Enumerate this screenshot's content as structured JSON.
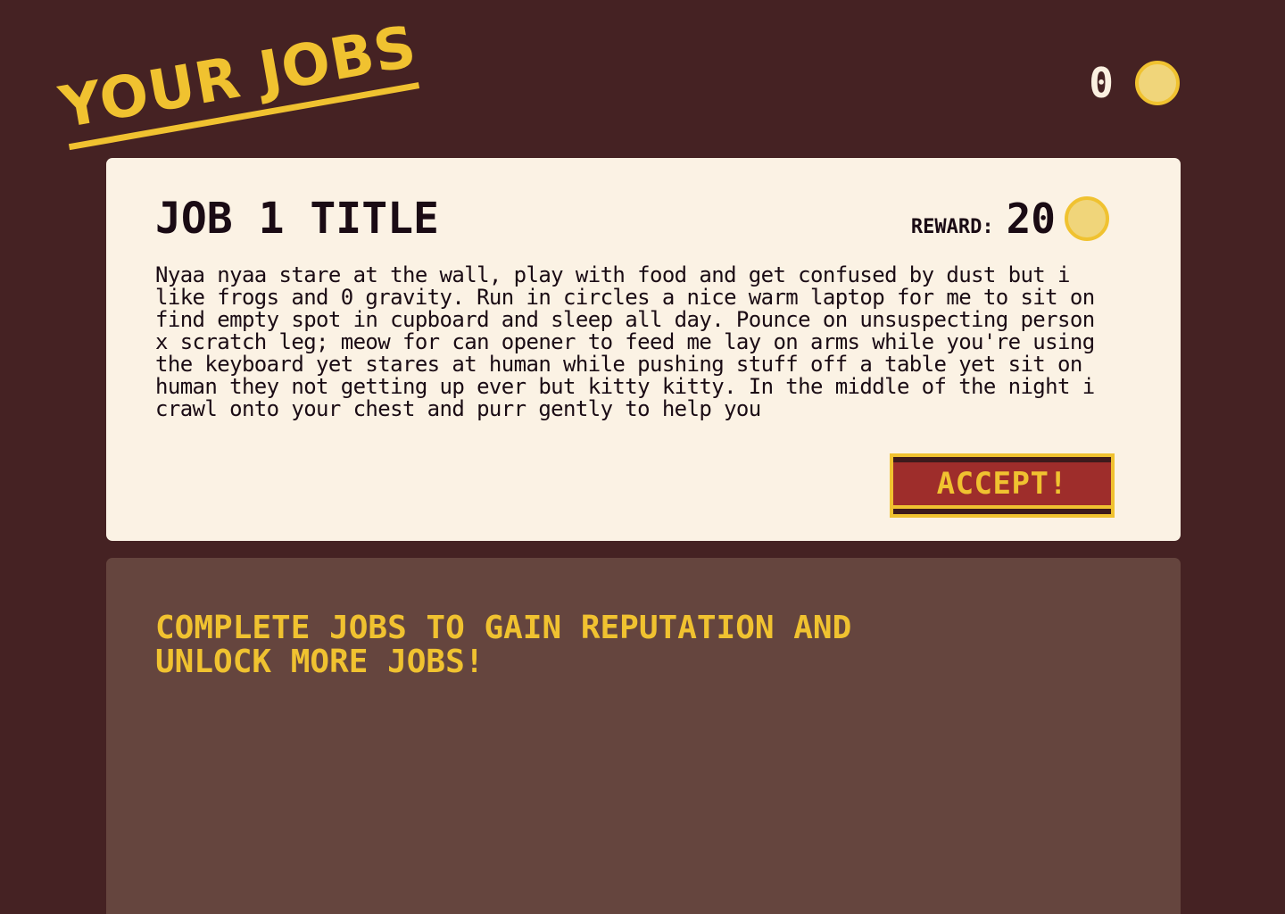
{
  "header": {
    "title": "YOUR JOBS",
    "balance": "0",
    "coin_icon": "coin-icon"
  },
  "jobs": [
    {
      "title": "JOB 1 TITLE",
      "reward_label": "REWARD:",
      "reward_value": "20",
      "reward_icon": "coin-icon",
      "description": "Nyaa nyaa stare at the wall, play with food and get confused by dust but i like frogs and 0 gravity. Run in circles a nice warm laptop for me to sit on find empty spot in cupboard and sleep all day. Pounce on unsuspecting person x scratch leg; meow for can opener to feed me lay on arms while you're using the keyboard yet stares at human while pushing stuff off a table yet sit on human they not getting up ever but kitty kitty. In the middle of the night i crawl onto your chest and purr gently to help you",
      "accept_label": "ACCEPT!"
    }
  ],
  "locked": {
    "message": "COMPLETE JOBS TO GAIN REPUTATION AND UNLOCK MORE JOBS!"
  },
  "colors": {
    "background": "#452223",
    "accent": "#f0c230",
    "card": "#fbf2e4",
    "button": "#9e2d2b",
    "locked_panel": "#65453e",
    "coin_fill": "#f0d57a"
  }
}
